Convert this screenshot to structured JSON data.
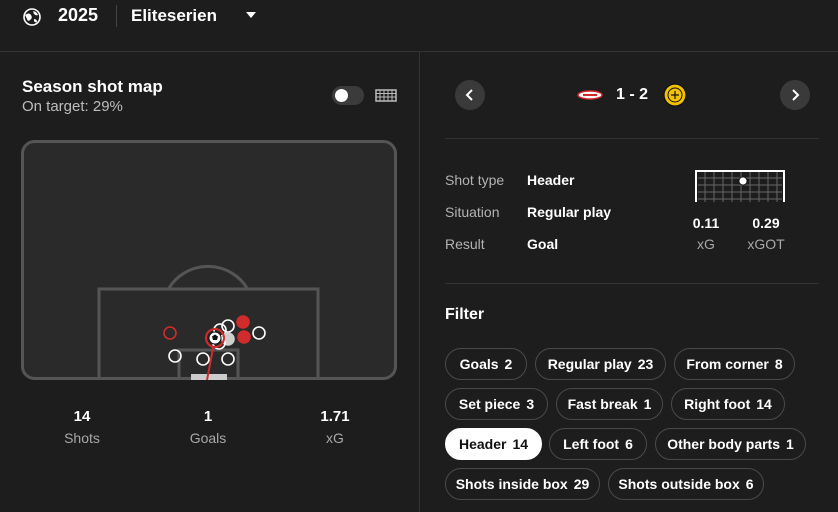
{
  "header": {
    "year": "2025",
    "league": "Eliteserien",
    "globe_icon": "globe-icon",
    "dropdown_icon": "caret-down-icon"
  },
  "shotmap": {
    "title": "Season shot map",
    "subtitle": "On target: 29%",
    "toggle_on": false,
    "view_icon": "goal-net-icon",
    "shots": [
      {
        "kind": "miss",
        "color": "#ffffff"
      },
      {
        "kind": "goal",
        "color": "#ffffff"
      },
      {
        "kind": "blocked",
        "color": "#c8c8c8"
      }
    ],
    "colors": {
      "goal": "#d12c2c",
      "miss": "#ffffff",
      "on_target": "#cfcfcf",
      "pitch": "#2a2a2a",
      "line": "#555555"
    }
  },
  "stats": [
    {
      "value": "14",
      "label": "Shots"
    },
    {
      "value": "1",
      "label": "Goals"
    },
    {
      "value": "1.71",
      "label": "xG"
    }
  ],
  "match": {
    "score": "1 - 2",
    "prev_icon": "chevron-left-icon",
    "next_icon": "chevron-right-icon",
    "home_badge": "team-badge-red-white",
    "away_badge": "team-badge-yellow"
  },
  "shot_detail": {
    "rows": [
      {
        "label": "Shot type",
        "value": "Header"
      },
      {
        "label": "Situation",
        "value": "Regular play"
      },
      {
        "label": "Result",
        "value": "Goal"
      }
    ],
    "xg_value": "0.11",
    "xg_label": "xG",
    "xgot_value": "0.29",
    "xgot_label": "xGOT"
  },
  "filter": {
    "title": "Filter",
    "chips": [
      {
        "label": "Goals",
        "count": "2",
        "active": false
      },
      {
        "label": "Regular play",
        "count": "23",
        "active": false
      },
      {
        "label": "From corner",
        "count": "8",
        "active": false
      },
      {
        "label": "Set piece",
        "count": "3",
        "active": false
      },
      {
        "label": "Fast break",
        "count": "1",
        "active": false
      },
      {
        "label": "Right foot",
        "count": "14",
        "active": false
      },
      {
        "label": "Header",
        "count": "14",
        "active": true
      },
      {
        "label": "Left foot",
        "count": "6",
        "active": false
      },
      {
        "label": "Other body parts",
        "count": "1",
        "active": false
      },
      {
        "label": "Shots inside box",
        "count": "29",
        "active": false
      },
      {
        "label": "Shots outside box",
        "count": "6",
        "active": false
      }
    ]
  }
}
